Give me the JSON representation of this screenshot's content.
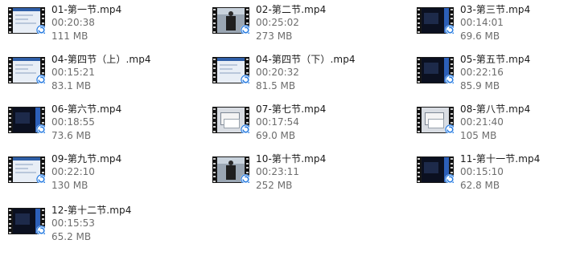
{
  "files": [
    {
      "name": "01-第一节.mp4",
      "duration": "00:20:38",
      "size": "111 MB",
      "thumb": "screen"
    },
    {
      "name": "02-第二节.mp4",
      "duration": "00:25:02",
      "size": "273 MB",
      "thumb": "person"
    },
    {
      "name": "03-第三节.mp4",
      "duration": "00:14:01",
      "size": "69.6 MB",
      "thumb": "dark"
    },
    {
      "name": "04-第四节（上）.mp4",
      "duration": "00:15:21",
      "size": "83.1 MB",
      "thumb": "screen"
    },
    {
      "name": "04-第四节（下）.mp4",
      "duration": "00:20:32",
      "size": "81.5 MB",
      "thumb": "screen"
    },
    {
      "name": "05-第五节.mp4",
      "duration": "00:22:16",
      "size": "85.9 MB",
      "thumb": "dark"
    },
    {
      "name": "06-第六节.mp4",
      "duration": "00:18:55",
      "size": "73.6 MB",
      "thumb": "dark"
    },
    {
      "name": "07-第七节.mp4",
      "duration": "00:17:54",
      "size": "69.0 MB",
      "thumb": "dialog"
    },
    {
      "name": "08-第八节.mp4",
      "duration": "00:21:40",
      "size": "105 MB",
      "thumb": "dialog"
    },
    {
      "name": "09-第九节.mp4",
      "duration": "00:22:10",
      "size": "130 MB",
      "thumb": "screen"
    },
    {
      "name": "10-第十节.mp4",
      "duration": "00:23:11",
      "size": "252 MB",
      "thumb": "person"
    },
    {
      "name": "11-第十一节.mp4",
      "duration": "00:15:10",
      "size": "62.8 MB",
      "thumb": "dark"
    },
    {
      "name": "12-第十二节.mp4",
      "duration": "00:15:53",
      "size": "65.2 MB",
      "thumb": "dark"
    }
  ],
  "icons": {
    "thumbnail": "video-thumbnail-icon",
    "badge": "media-player-badge-icon"
  },
  "colors": {
    "name_text": "#1b1b1b",
    "meta_text": "#6d6d6d",
    "badge_blue": "#2a7de1",
    "background": "#ffffff"
  }
}
